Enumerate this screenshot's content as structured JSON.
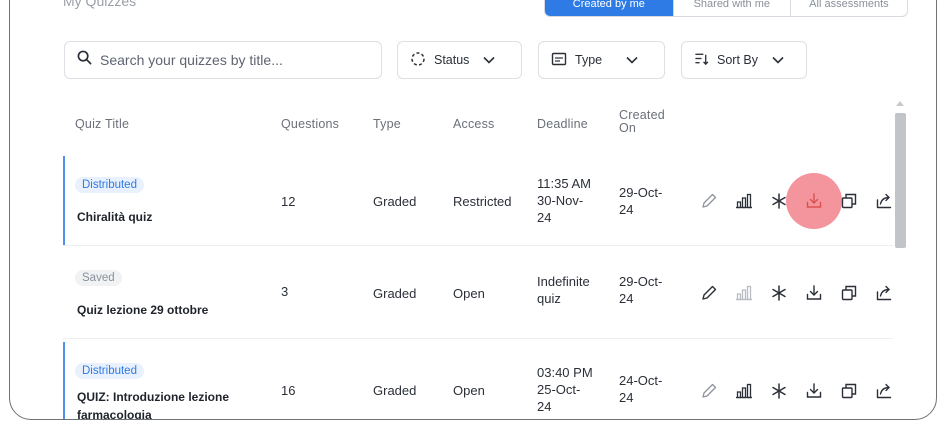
{
  "header": {
    "page_title": "My Quizzes",
    "segments": [
      "Created by me",
      "Shared with me",
      "All assessments"
    ]
  },
  "search": {
    "placeholder": "Search your quizzes by title..."
  },
  "filters": {
    "status_label": "Status",
    "type_label": "Type",
    "sort_label": "Sort By"
  },
  "table": {
    "headers": {
      "title": "Quiz Title",
      "questions": "Questions",
      "type": "Type",
      "access": "Access",
      "deadline": "Deadline",
      "created_line1": "Created",
      "created_line2": "On"
    },
    "rows": [
      {
        "status": "Distributed",
        "title": "Chiralità quiz",
        "questions": "12",
        "type": "Graded",
        "access": "Restricted",
        "deadline_lines": [
          "11:35 AM",
          "30-Nov-",
          "24"
        ],
        "created_lines": [
          "29-Oct-",
          "24"
        ]
      },
      {
        "status": "Saved",
        "title": "Quiz lezione 29 ottobre",
        "questions": "3",
        "type": "Graded",
        "access": "Open",
        "deadline_lines": [
          "Indefinite",
          "quiz"
        ],
        "created_lines": [
          "29-Oct-",
          "24"
        ]
      },
      {
        "status": "Distributed",
        "title_lines": [
          "QUIZ: Introduzione lezione",
          "farmacologia"
        ],
        "questions": "16",
        "type": "Graded",
        "access": "Open",
        "deadline_lines": [
          "03:40 PM",
          "25-Oct-",
          "24"
        ],
        "created_lines": [
          "24-Oct-",
          "24"
        ]
      }
    ],
    "row_icons": [
      "edit-icon",
      "analytics-icon",
      "asterisk-icon",
      "download-icon",
      "duplicate-icon",
      "share-icon"
    ]
  },
  "colors": {
    "accent": "#2f7be6",
    "highlight": "#f3858f",
    "distributed_badge_bg": "#e8f1fd",
    "saved_badge_bg": "#f1f2f4"
  }
}
